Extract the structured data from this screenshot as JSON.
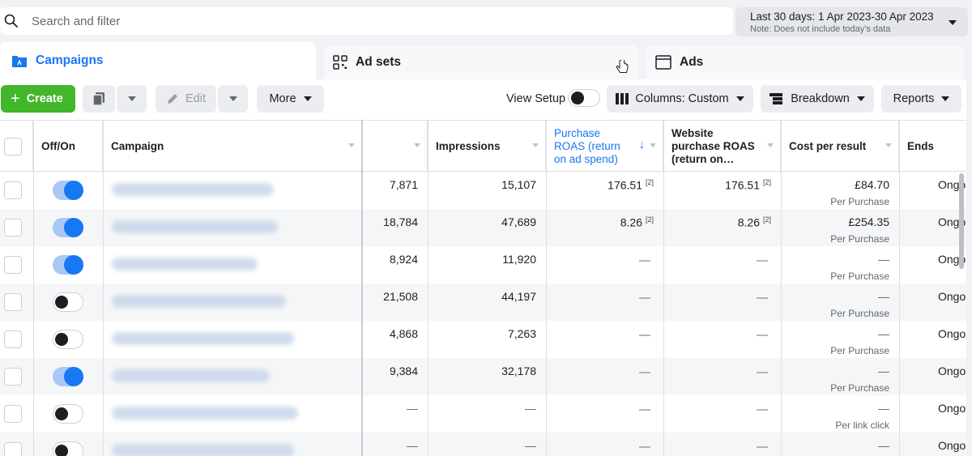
{
  "search": {
    "placeholder": "Search and filter"
  },
  "date_range": {
    "label": "Last 30 days: 1 Apr 2023-30 Apr 2023",
    "note": "Note: Does not include today's data"
  },
  "tabs": [
    {
      "label": "Campaigns",
      "icon": "folder-icon"
    },
    {
      "label": "Ad sets",
      "icon": "grid-icon"
    },
    {
      "label": "Ads",
      "icon": "ad-window-icon"
    }
  ],
  "toolbar": {
    "create_label": "Create",
    "edit_label": "Edit",
    "more_label": "More",
    "view_setup_label": "View Setup",
    "columns_label": "Columns: Custom",
    "breakdown_label": "Breakdown",
    "reports_label": "Reports"
  },
  "columns": {
    "offon": "Off/On",
    "campaign": "Campaign",
    "results": "",
    "impressions": "Impressions",
    "purchase_roas": "Purchase ROAS (return on ad spend)",
    "website_roas": "Website purchase ROAS (return on…",
    "cost_per_result": "Cost per result",
    "ends": "Ends"
  },
  "rows": [
    {
      "on": true,
      "results": "7,871",
      "impressions": "15,107",
      "roas": "176.51",
      "roas_sup": "[2]",
      "web_roas": "176.51",
      "web_sup": "[2]",
      "cost": "£84.70",
      "cost_type": "Per Purchase",
      "ends": "Ongoi"
    },
    {
      "on": true,
      "results": "18,784",
      "impressions": "47,689",
      "roas": "8.26",
      "roas_sup": "[2]",
      "web_roas": "8.26",
      "web_sup": "[2]",
      "cost": "£254.35",
      "cost_type": "Per Purchase",
      "ends": "Ongoi"
    },
    {
      "on": true,
      "results": "8,924",
      "impressions": "11,920",
      "roas": "—",
      "roas_sup": "",
      "web_roas": "—",
      "web_sup": "",
      "cost": "—",
      "cost_type": "Per Purchase",
      "ends": "Ongoi"
    },
    {
      "on": false,
      "results": "21,508",
      "impressions": "44,197",
      "roas": "—",
      "roas_sup": "",
      "web_roas": "—",
      "web_sup": "",
      "cost": "—",
      "cost_type": "Per Purchase",
      "ends": "Ongoi"
    },
    {
      "on": false,
      "results": "4,868",
      "impressions": "7,263",
      "roas": "—",
      "roas_sup": "",
      "web_roas": "—",
      "web_sup": "",
      "cost": "—",
      "cost_type": "Per Purchase",
      "ends": "Ongoi"
    },
    {
      "on": true,
      "results": "9,384",
      "impressions": "32,178",
      "roas": "—",
      "roas_sup": "",
      "web_roas": "—",
      "web_sup": "",
      "cost": "—",
      "cost_type": "Per Purchase",
      "ends": "Ongoi"
    },
    {
      "on": false,
      "results": "—",
      "impressions": "—",
      "roas": "—",
      "roas_sup": "",
      "web_roas": "—",
      "web_sup": "",
      "cost": "—",
      "cost_type": "Per link click",
      "ends": "Ongoi"
    },
    {
      "on": false,
      "results": "—",
      "impressions": "—",
      "roas": "—",
      "roas_sup": "",
      "web_roas": "—",
      "web_sup": "",
      "cost": "—",
      "cost_type": "",
      "ends": "Ongoi"
    }
  ],
  "colors": {
    "accent": "#1877f2",
    "create": "#42b72a"
  }
}
